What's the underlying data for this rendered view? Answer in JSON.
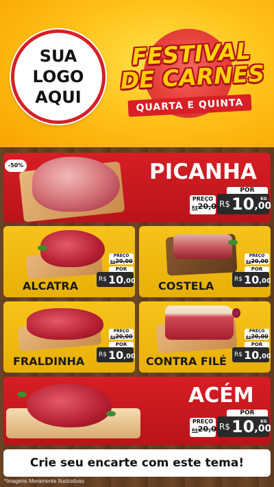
{
  "logo": {
    "line1": "SUA",
    "line2": "LOGO",
    "line3": "AQUI"
  },
  "festival": {
    "title_line1": "FESTIVAL",
    "title_line2": "DE CARNES",
    "subtitle": "QUARTA E QUINTA"
  },
  "currency": "R$",
  "unit": "KG",
  "labels": {
    "from": "PREÇO",
    "per": "POR"
  },
  "products": [
    {
      "name": "PICANHA",
      "old_price": "20,00",
      "price_int": "10",
      "price_dec": ",00",
      "badge": "-50%"
    },
    {
      "name": "ALCATRA",
      "old_price": "20,00",
      "price_int": "10",
      "price_dec": ",00"
    },
    {
      "name": "COSTELA",
      "old_price": "20,00",
      "price_int": "10",
      "price_dec": ",00"
    },
    {
      "name": "FRALDINHA",
      "old_price": "20,00",
      "price_int": "10",
      "price_dec": ",00"
    },
    {
      "name": "CONTRA FILÉ",
      "old_price": "20,00",
      "price_int": "10",
      "price_dec": ",00"
    },
    {
      "name": "ACÉM",
      "old_price": "20,00",
      "price_int": "10",
      "price_dec": ",00"
    }
  ],
  "old_prefix": "R$",
  "footer": "Crie seu encarte com este tema!",
  "disclaimer": "*Imagens Meramente Ilustrativas",
  "colors": {
    "red": "#d61e25",
    "yellow": "#f6c31c",
    "wood": "#5d3a1f"
  }
}
